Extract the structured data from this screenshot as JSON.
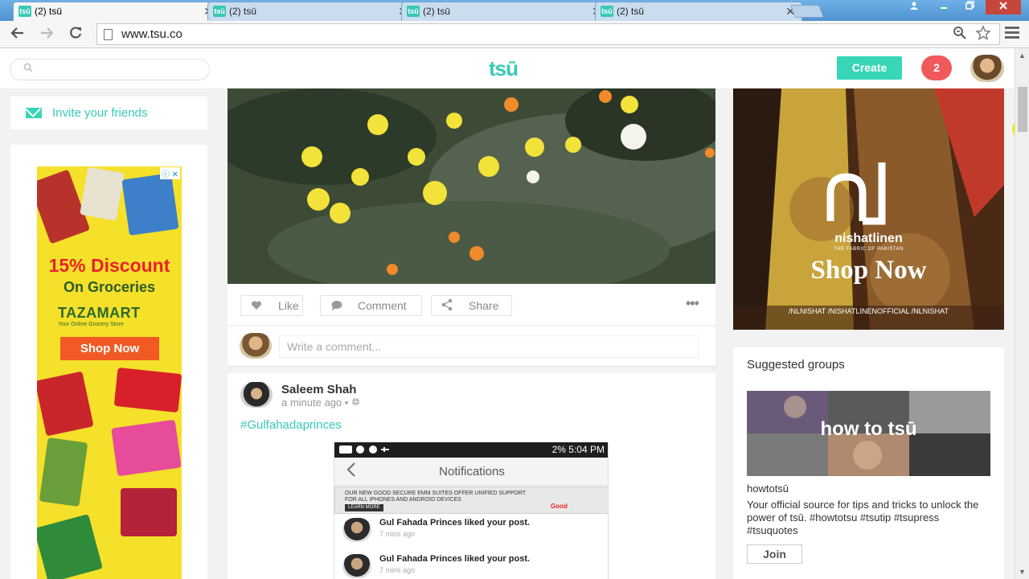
{
  "browser": {
    "tabs": [
      {
        "favicon": "tsū",
        "title": "(2) tsū",
        "active": true
      },
      {
        "favicon": "tsū",
        "title": "(2) tsū",
        "active": false
      },
      {
        "favicon": "tsū",
        "title": "(2) tsū",
        "active": false
      },
      {
        "favicon": "tsū",
        "title": "(2) tsū",
        "active": false
      }
    ],
    "tab_close": "✕",
    "url": "www.tsu.co"
  },
  "header": {
    "logo": "tsū",
    "create_label": "Create",
    "notification_count": "2"
  },
  "left": {
    "invite_label": "Invite your friends",
    "ad": {
      "discount": "15% Discount",
      "subtitle": "On Groceries",
      "brand": "TAZAMART",
      "tagline": "Your Online Grocery Store",
      "cta": "Shop Now"
    }
  },
  "post1": {
    "actions": {
      "like": "Like",
      "comment": "Comment",
      "share": "Share"
    },
    "more": "•••",
    "comment_placeholder": "Write a comment..."
  },
  "post2": {
    "author": "Saleem Shah",
    "time": "a minute ago •",
    "hashtag": "#Gulfahadaprinces",
    "screenshot": {
      "status_time": "5:04 PM",
      "status_battery": "2%",
      "title": "Notifications",
      "ad_text": "OUR NEW GOOD SECURE EMM SUITES OFFER UNIFIED SUPPORT FOR ALL IPHONES AND ANDROID DEVICES",
      "ad_button": "LEARN MORE",
      "ad_brand": "Good",
      "items": [
        {
          "message": "Gul Fahada Princes liked your post.",
          "time": "7 mins ago"
        },
        {
          "message": "Gul Fahada Princes liked your post.",
          "time": "7 mins ago"
        }
      ]
    }
  },
  "right": {
    "ad": {
      "brand": "nishatlinen",
      "tagline": "THE FABRIC OF PAKISTAN",
      "cta": "Shop Now",
      "social": "/NLNISHAT   /NISHATLINENOFFICIAL   /NLNISHAT"
    },
    "suggested": {
      "heading": "Suggested groups",
      "image_text": "how to tsū",
      "name": "howtotsū",
      "description": "Your official source for tips and tricks to unlock the power of tsū. #howtotsu #tsutip #tsupress #tsuquotes",
      "join_label": "Join"
    }
  },
  "colors": {
    "brand": "#38c9b6",
    "create": "#38d6b6",
    "notification": "#f05a5a"
  }
}
